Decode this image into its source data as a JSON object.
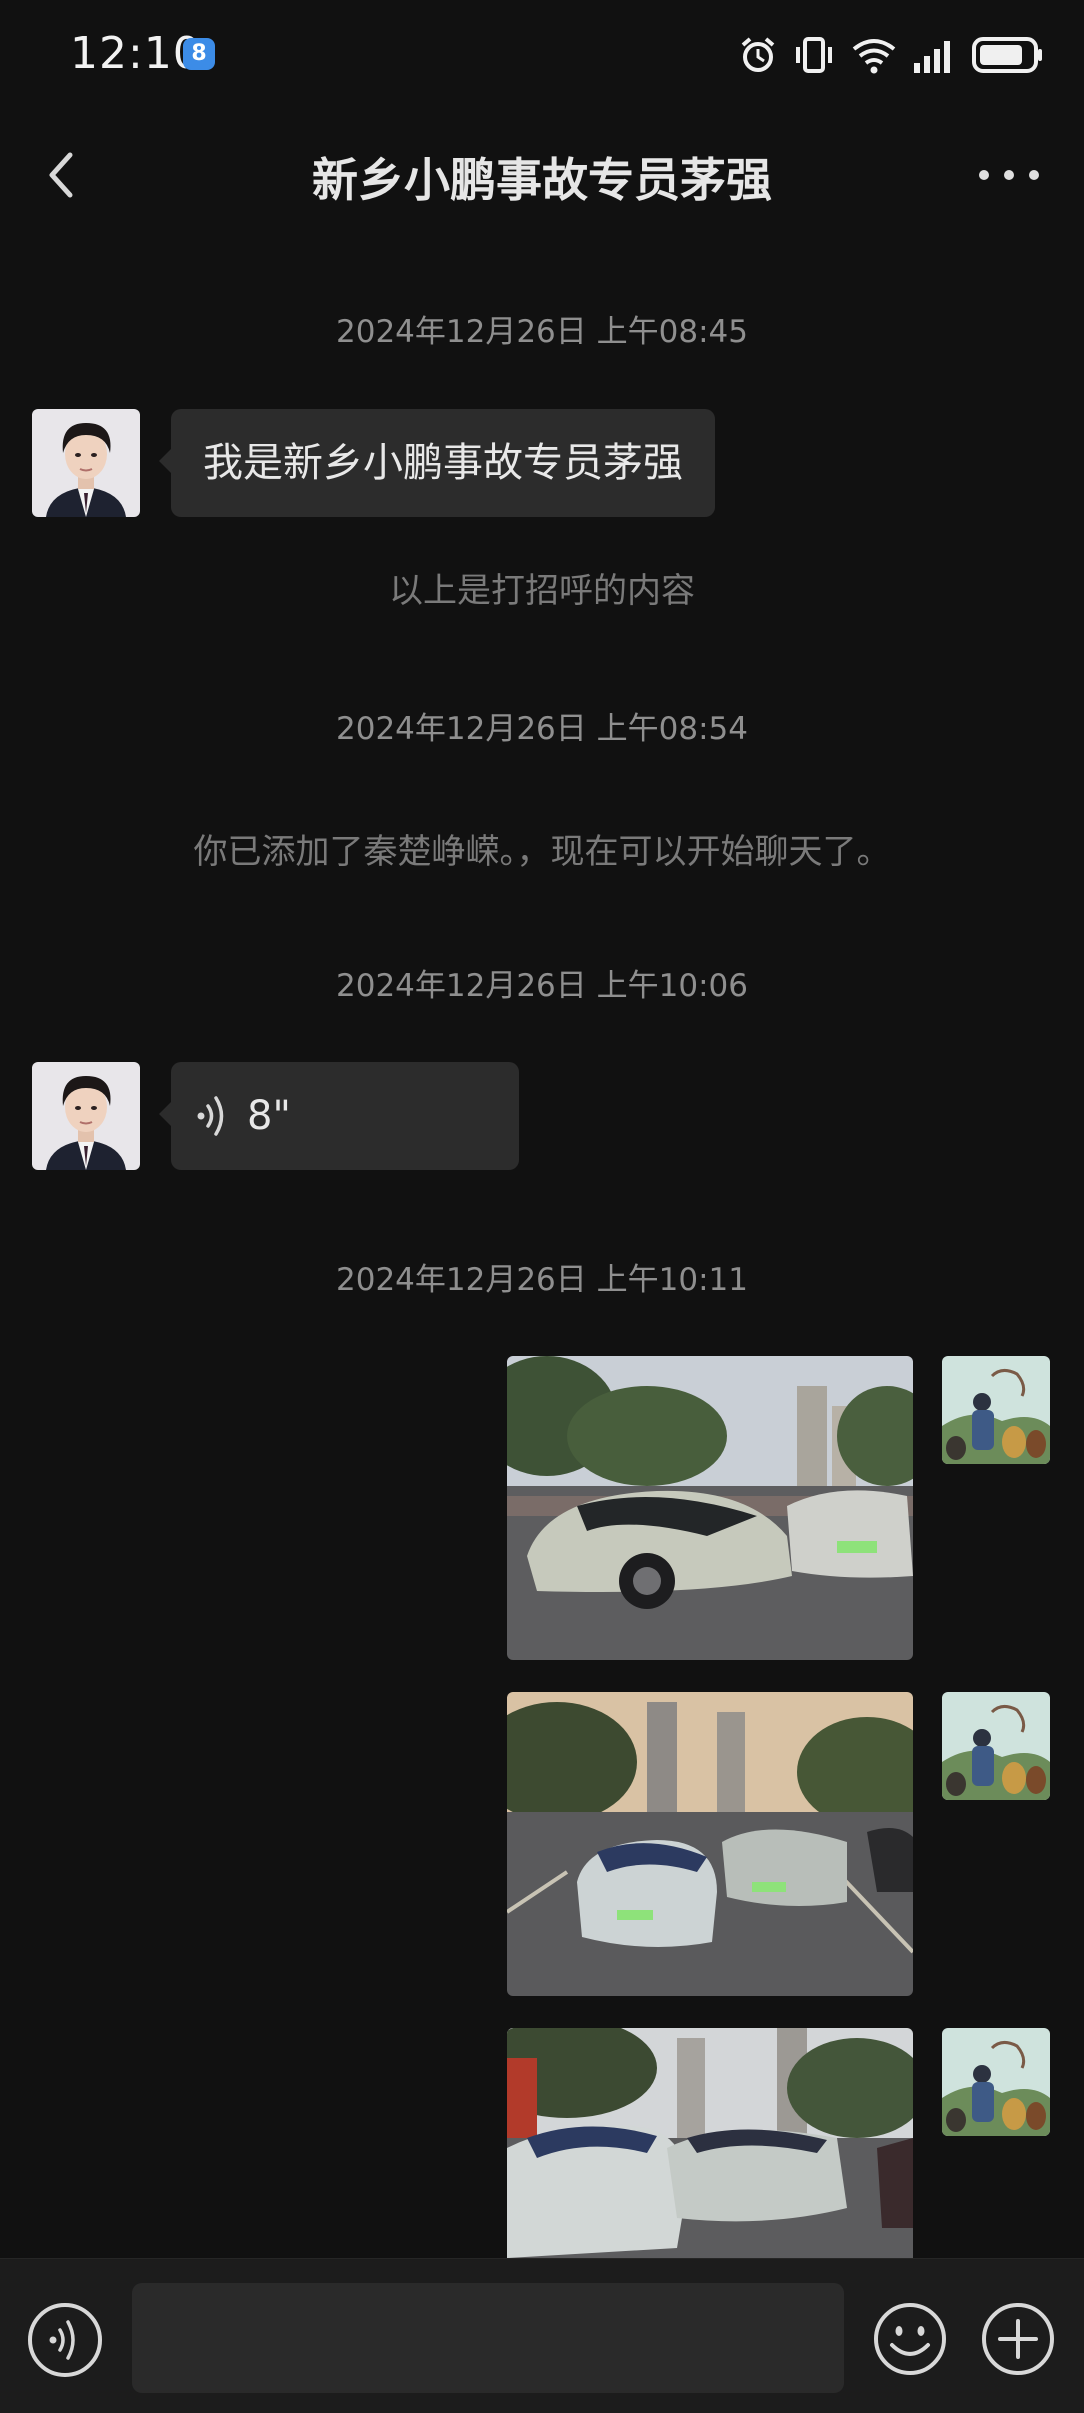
{
  "status_bar": {
    "time": "12:10",
    "badge": "8"
  },
  "header": {
    "title": "新乡小鹏事故专员茅强"
  },
  "messages": [
    {
      "timestamp": "2024年12月26日 上午08:45"
    },
    {
      "text": "我是新乡小鹏事故专员茅强"
    },
    {
      "system": "以上是打招呼的内容"
    },
    {
      "timestamp": "2024年12月26日 上午08:54"
    },
    {
      "system": "你已添加了秦楚峥嵘。，现在可以开始聊天了。"
    },
    {
      "timestamp": "2024年12月26日 上午10:06"
    },
    {
      "voice_duration": "8\""
    },
    {
      "timestamp": "2024年12月26日 上午10:11"
    }
  ],
  "colors": {
    "background": "#111111",
    "bubble": "#2c2c2c",
    "input_bar": "#1c1c1c"
  },
  "icons": {
    "back": "chevron-left-icon",
    "more": "more-icon",
    "voice": "voice-icon",
    "emoji": "emoji-icon",
    "plus": "plus-icon"
  }
}
